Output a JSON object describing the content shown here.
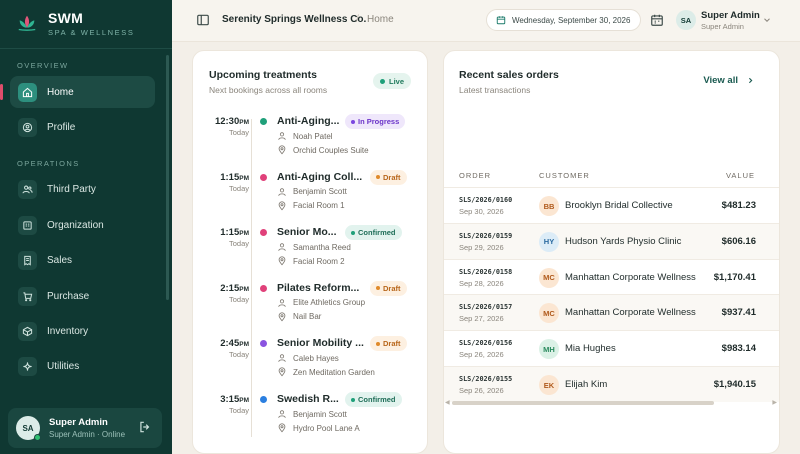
{
  "brand": {
    "name": "SWM",
    "tagline": "SPA & WELLNESS"
  },
  "sidebar": {
    "section_overview": "OVERVIEW",
    "section_operations": "OPERATIONS",
    "items": [
      {
        "label": "Home",
        "icon": "home-icon",
        "active": true
      },
      {
        "label": "Profile",
        "icon": "user-circle-icon"
      },
      {
        "label": "Third Party",
        "icon": "users-icon"
      },
      {
        "label": "Organization",
        "icon": "building-icon"
      },
      {
        "label": "Sales",
        "icon": "receipt-icon"
      },
      {
        "label": "Purchase",
        "icon": "cart-icon"
      },
      {
        "label": "Inventory",
        "icon": "box-icon"
      },
      {
        "label": "Utilities",
        "icon": "sparkle-icon"
      }
    ],
    "user": {
      "initials": "SA",
      "name": "Super Admin",
      "status": "Super Admin · Online"
    }
  },
  "topbar": {
    "org": "Serenity Springs Wellness Co.",
    "separator": "/",
    "page": "Home",
    "date": "Wednesday, September 30, 2026",
    "user_initials": "SA",
    "user_name": "Super Admin",
    "user_role": "Super Admin"
  },
  "treatments": {
    "title": "Upcoming treatments",
    "subtitle": "Next bookings across all rooms",
    "live_label": "Live",
    "items": [
      {
        "time": "12:30",
        "ampm": "PM",
        "day": "Today",
        "name": "Anti-Aging...",
        "status": "In Progress",
        "dot": "#1fa07a",
        "person": "Noah Patel",
        "room": "Orchid Couples Suite"
      },
      {
        "time": "1:15",
        "ampm": "PM",
        "day": "Today",
        "name": "Anti-Aging Coll...",
        "status": "Draft",
        "dot": "#e0417a",
        "person": "Benjamin Scott",
        "room": "Facial Room 1"
      },
      {
        "time": "1:15",
        "ampm": "PM",
        "day": "Today",
        "name": "Senior Mo...",
        "status": "Confirmed",
        "dot": "#e0417a",
        "person": "Samantha Reed",
        "room": "Facial Room 2"
      },
      {
        "time": "2:15",
        "ampm": "PM",
        "day": "Today",
        "name": "Pilates Reform...",
        "status": "Draft",
        "dot": "#e0417a",
        "person": "Elite Athletics Group",
        "room": "Nail Bar"
      },
      {
        "time": "2:45",
        "ampm": "PM",
        "day": "Today",
        "name": "Senior Mobility ...",
        "status": "Draft",
        "dot": "#8a54e0",
        "person": "Caleb Hayes",
        "room": "Zen Meditation Garden"
      },
      {
        "time": "3:15",
        "ampm": "PM",
        "day": "Today",
        "name": "Swedish R...",
        "status": "Confirmed",
        "dot": "#2b7fe0",
        "person": "Benjamin Scott",
        "room": "Hydro Pool Lane A"
      }
    ]
  },
  "sales": {
    "title": "Recent sales orders",
    "subtitle": "Latest transactions",
    "view_all": "View all",
    "columns": {
      "order": "ORDER",
      "customer": "CUSTOMER",
      "value": "VALUE"
    },
    "rows": [
      {
        "order": "SLS/2026/0160",
        "date": "Sep 30, 2026",
        "initials": "BB",
        "customer": "Brooklyn Bridal Collective",
        "value": "$481.23",
        "av_bg": "#fbe6d2",
        "av_fg": "#b05a1c"
      },
      {
        "order": "SLS/2026/0159",
        "date": "Sep 29, 2026",
        "initials": "HY",
        "customer": "Hudson Yards Physio Clinic",
        "value": "$606.16",
        "av_bg": "#dcecf7",
        "av_fg": "#2a6aa0"
      },
      {
        "order": "SLS/2026/0158",
        "date": "Sep 28, 2026",
        "initials": "MC",
        "customer": "Manhattan Corporate Wellness",
        "value": "$1,170.41",
        "av_bg": "#fbe6d2",
        "av_fg": "#b05a1c"
      },
      {
        "order": "SLS/2026/0157",
        "date": "Sep 27, 2026",
        "initials": "MC",
        "customer": "Manhattan Corporate Wellness",
        "value": "$937.41",
        "av_bg": "#fbe6d2",
        "av_fg": "#b05a1c"
      },
      {
        "order": "SLS/2026/0156",
        "date": "Sep 26, 2026",
        "initials": "MH",
        "customer": "Mia Hughes",
        "value": "$983.14",
        "av_bg": "#dbf1e6",
        "av_fg": "#2a8a5e"
      },
      {
        "order": "SLS/2026/0155",
        "date": "Sep 26, 2026",
        "initials": "EK",
        "customer": "Elijah Kim",
        "value": "$1,940.15",
        "av_bg": "#fbe6d2",
        "av_fg": "#b05a1c"
      }
    ]
  },
  "status_styles": {
    "In Progress": {
      "bg": "#efe7fb",
      "fg": "#6c35c9",
      "dot": "#7b46e0"
    },
    "Draft": {
      "bg": "#fdf0e1",
      "fg": "#b8661a",
      "dot": "#e08a2b"
    },
    "Confirmed": {
      "bg": "#e2f3ee",
      "fg": "#1f6e58",
      "dot": "#1fa07a"
    }
  }
}
